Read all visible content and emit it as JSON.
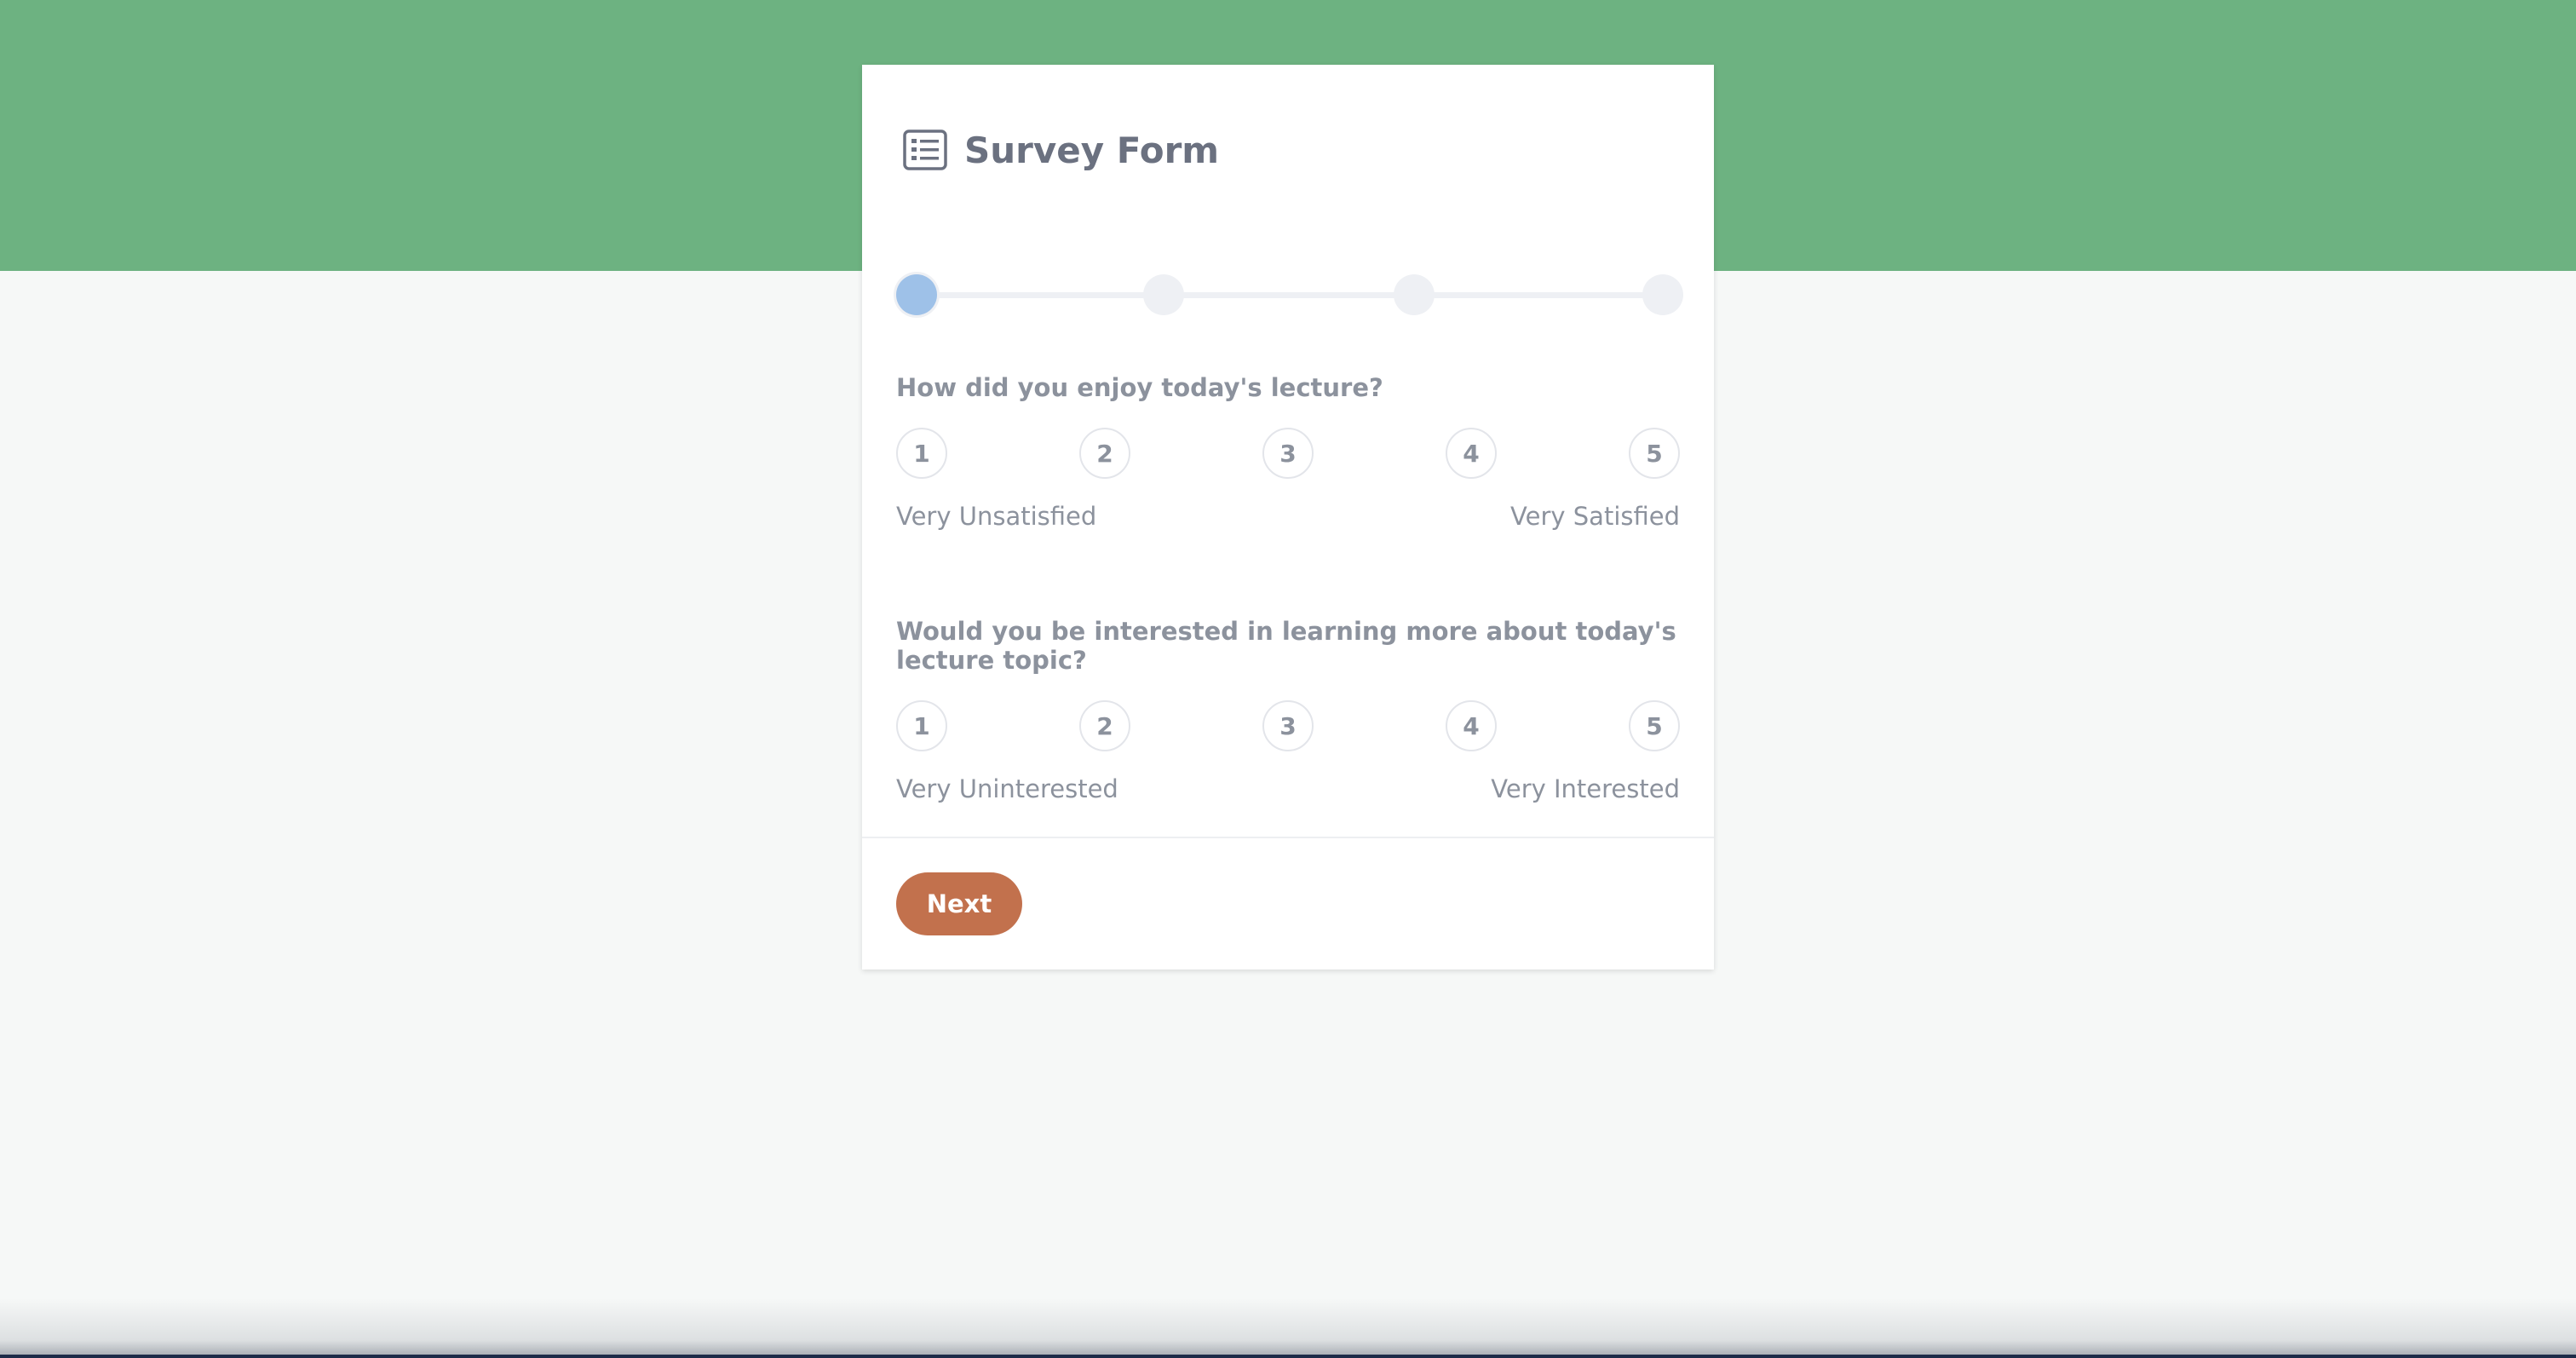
{
  "colors": {
    "header_band": "#6db281",
    "page_background": "#f6f8f7",
    "active_step": "#9ec1e8",
    "inactive_step": "#eef0f4",
    "next_button": "#c2714d",
    "text": "#8c929d"
  },
  "header": {
    "icon": "list-icon",
    "title": "Survey Form"
  },
  "progress": {
    "total_steps": 4,
    "current_step": 1
  },
  "questions": [
    {
      "label": "How did you enjoy today's lecture?",
      "options": [
        "1",
        "2",
        "3",
        "4",
        "5"
      ],
      "min_label": "Very Unsatisfied",
      "max_label": "Very Satisfied"
    },
    {
      "label": "Would you be interested in learning more about today's lecture topic?",
      "options": [
        "1",
        "2",
        "3",
        "4",
        "5"
      ],
      "min_label": "Very Uninterested",
      "max_label": "Very Interested"
    }
  ],
  "footer": {
    "next_label": "Next"
  }
}
